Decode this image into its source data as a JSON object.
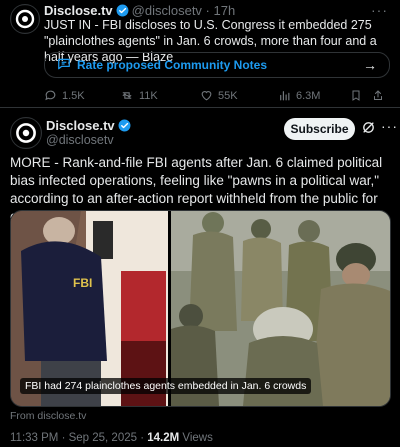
{
  "quoted_tweet": {
    "author_name": "Disclose.tv",
    "handle_time": "@disclosetv · 17h",
    "text": "JUST IN - FBI discloses to U.S. Congress it embedded 275 \"plainclothes agents\" in Jan. 6 crowds, more than four and a half years ago — Blaze",
    "community_notes_label": "Rate proposed Community Notes",
    "actions": {
      "replies": "1.5K",
      "reposts": "11K",
      "likes": "55K",
      "views": "6.3M"
    }
  },
  "main_tweet": {
    "author_name": "Disclose.tv",
    "handle": "@disclosetv",
    "subscribe_label": "Subscribe",
    "text": "MORE - Rank-and-file FBI agents after Jan. 6 claimed political bias infected operations, feeling like \"pawns in a political war,\" according to an after-action report withheld from the public for over four years.",
    "media_caption": "FBI had 274 plainclothes agents embedded in Jan. 6 crowds",
    "media_source": "From disclose.tv",
    "timestamp": "11:33 PM · Sep 25, 2025 · ",
    "view_count": "14.2M",
    "views_label": " Views"
  },
  "colors": {
    "background": "#000000",
    "accent_blue": "#1d9bf0",
    "muted_text": "#71767b",
    "border": "#2f3336"
  }
}
